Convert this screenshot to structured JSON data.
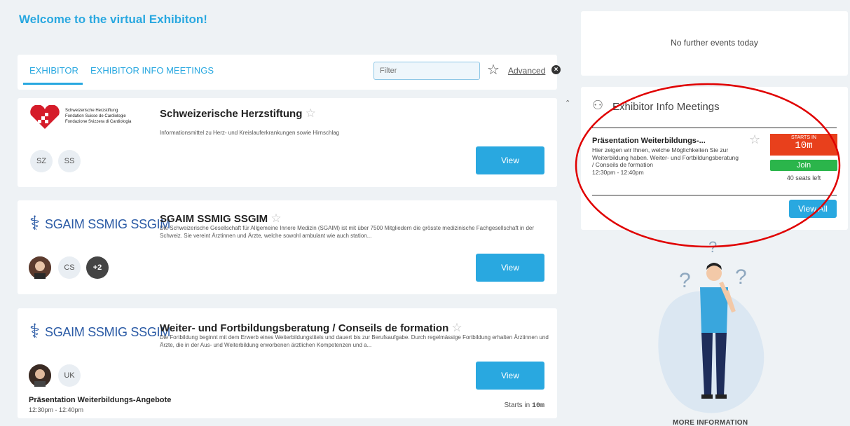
{
  "welcome": "Welcome to the virtual Exhibiton!",
  "tabs": [
    {
      "label": "EXHIBITOR"
    },
    {
      "label": "EXHIBITOR INFO MEETINGS"
    }
  ],
  "filter": {
    "placeholder": "Filter",
    "advanced_label": "Advanced"
  },
  "exhibitors": [
    {
      "title": "Schweizerische Herzstiftung",
      "logo_lines": [
        "Schweizerische Herzstiftung",
        "Fondation Suisse de Cardiologie",
        "Fondazione Svizzera di Cardiologia"
      ],
      "description": "Informationsmittel zu Herz- und Kreislauferkrankungen sowie Hirnschlag",
      "avatars": [
        "SZ",
        "SS"
      ],
      "view_label": "View"
    },
    {
      "title": "SGAIM SSMIG SSGIM",
      "logo_text": "SGAIM SSMIG SSGIM",
      "description": "Die Schweizerische Gesellschaft für Allgemeine Innere Medizin (SGAIM) ist mit über 7500 Mitgliedern die grösste medizinische Fachgesellschaft in der Schweiz. Sie vereint Ärztinnen und Ärzte, welche sowohl ambulant wie auch station...",
      "avatars": [
        "CS",
        "+2"
      ],
      "view_label": "View"
    },
    {
      "title": "Weiter- und Fortbildungsberatung / Conseils de formation",
      "logo_text": "SGAIM SSMIG SSGIM",
      "description": "Die Fortbildung beginnt mit dem Erwerb eines Weiterbildungstitels und dauert bis zur Berufsaufgabe. Durch regelmässige Fortbildung erhalten Ärztinnen und Ärzte, die in der Aus- und Weiterbildung erworbenen ärztlichen Kompetenzen und a...",
      "avatars": [
        "UK"
      ],
      "view_label": "View",
      "session": {
        "title": "Präsentation Weiterbildungs-Angebote",
        "time": "12:30pm - 12:40pm",
        "starts_label": "Starts in",
        "starts_value": "10m"
      }
    }
  ],
  "sidebar": {
    "no_events": "No further events today",
    "info_meetings": {
      "title": "Exhibitor Info Meetings",
      "meeting": {
        "title": "Präsentation Weiterbildungs-...",
        "description": "Hier zeigen wir Ihnen, welche Möglichkeiten Sie zur Weiterbildung haben. Weiter- und Fortbildungsberatung / Conseils de formation",
        "time": "12:30pm - 12:40pm",
        "starts_label": "STARTS IN",
        "starts_value": "10m",
        "join_label": "Join",
        "seats": "40 seats left"
      },
      "view_all_label": "View All"
    },
    "more_info": "MORE INFORMATION"
  },
  "colors": {
    "accent": "#29a8e0",
    "starts": "#e8401c",
    "join": "#2bb54b",
    "annotation": "#e00000"
  }
}
